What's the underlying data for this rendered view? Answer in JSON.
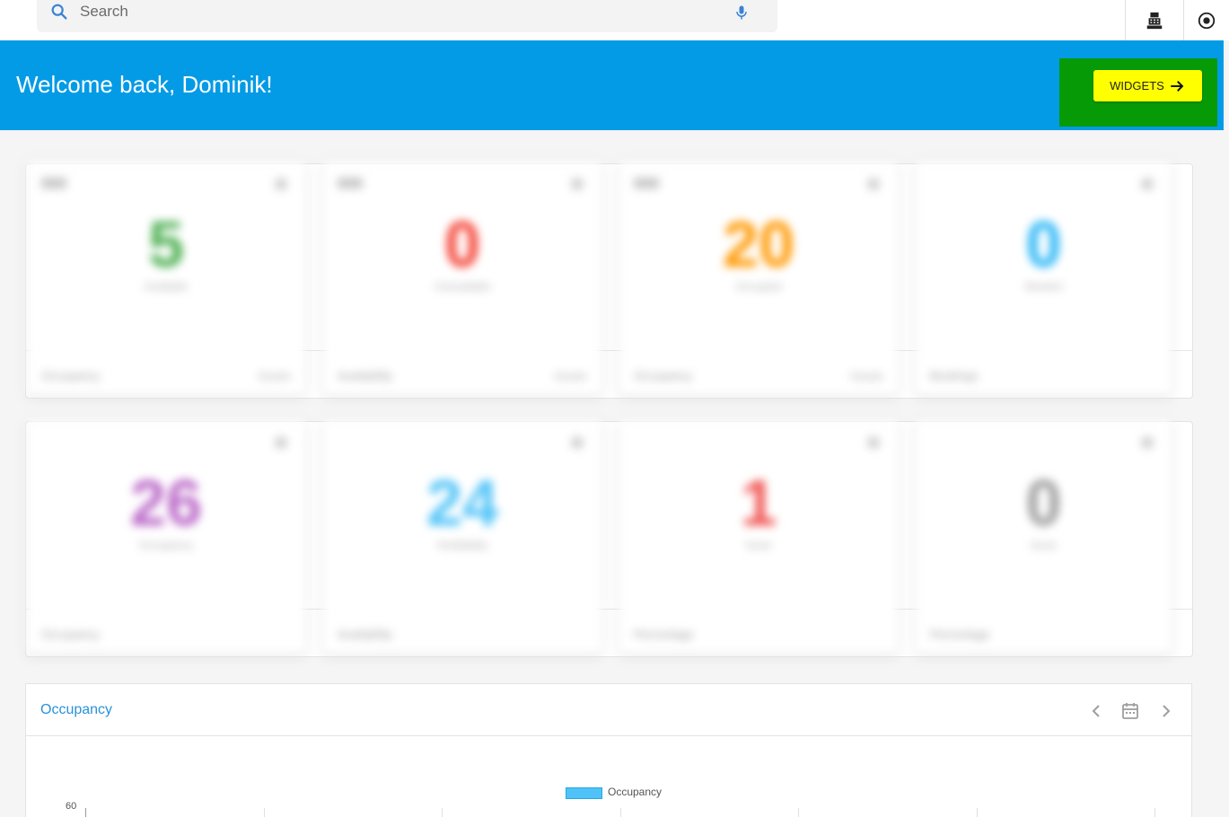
{
  "search": {
    "placeholder": "Search"
  },
  "banner": {
    "welcome": "Welcome back, Dominik!",
    "widgets_label": "WIDGETS"
  },
  "cards_row1": [
    {
      "value": "5",
      "label": "Available",
      "color": "#4caf50",
      "footer": "Occupancy",
      "footer_right": "Details"
    },
    {
      "value": "0",
      "label": "Unavailable",
      "color": "#f44336",
      "footer": "Availability",
      "footer_right": "Details"
    },
    {
      "value": "20",
      "label": "Occupied",
      "color": "#ff9800",
      "footer": "Occupancy",
      "footer_right": "Details"
    },
    {
      "value": "0",
      "label": "Booked",
      "color": "#29b6f6",
      "footer": "Bookings",
      "footer_right": ""
    }
  ],
  "cards_row2": [
    {
      "value": "26",
      "label": "Occupancy",
      "color": "#ba68c8",
      "footer": "Occupancy",
      "footer_right": ""
    },
    {
      "value": "24",
      "label": "Availability",
      "color": "#4fc3f7",
      "footer": "Availability",
      "footer_right": ""
    },
    {
      "value": "1",
      "label": "Issue",
      "color": "#ef5350",
      "footer": "Percentage",
      "footer_right": ""
    },
    {
      "value": "0",
      "label": "Issue",
      "color": "#9e9e9e",
      "footer": "Percentage",
      "footer_right": ""
    }
  ],
  "occupancy": {
    "title": "Occupancy",
    "legend": "Occupancy",
    "y_top_tick": "60"
  },
  "colors": {
    "banner": "#039be5",
    "widgets_highlight": "#079a07",
    "widgets_button": "#ffff00",
    "accent": "#2a92d8"
  },
  "icons": [
    "search-icon",
    "microphone-icon",
    "cash-register-icon",
    "record-icon",
    "arrow-right-icon",
    "chevron-left-icon",
    "calendar-icon",
    "chevron-right-icon"
  ]
}
